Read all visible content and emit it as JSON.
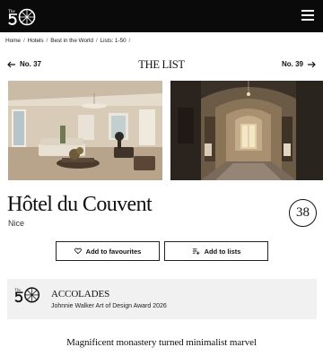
{
  "header": {
    "logo_alt_top": "The",
    "logo_alt_number": "50",
    "menu_icon": "hamburger-menu-icon"
  },
  "breadcrumb": [
    "Home",
    "Hotels",
    "Best in the World",
    "Lists: 1-50"
  ],
  "list_nav": {
    "prev_label": "No. 37",
    "title": "THE LIST",
    "next_label": "No. 39"
  },
  "hotel": {
    "name": "Hôtel du Couvent",
    "city": "Nice",
    "rank": "38"
  },
  "actions": {
    "favourite_label": "Add to favourites",
    "favourite_icon": "heart-icon",
    "lists_label": "Add to lists",
    "lists_icon": "list-add-icon"
  },
  "accolades": {
    "heading": "ACCOLADES",
    "award": "Johnnie Walker Art of Design Award 2026"
  },
  "tagline": "Magnificent monastery turned minimalist marvel",
  "colors": {
    "header_bg": "#0a0a0a",
    "accolade_bg": "#f1f1f1"
  }
}
